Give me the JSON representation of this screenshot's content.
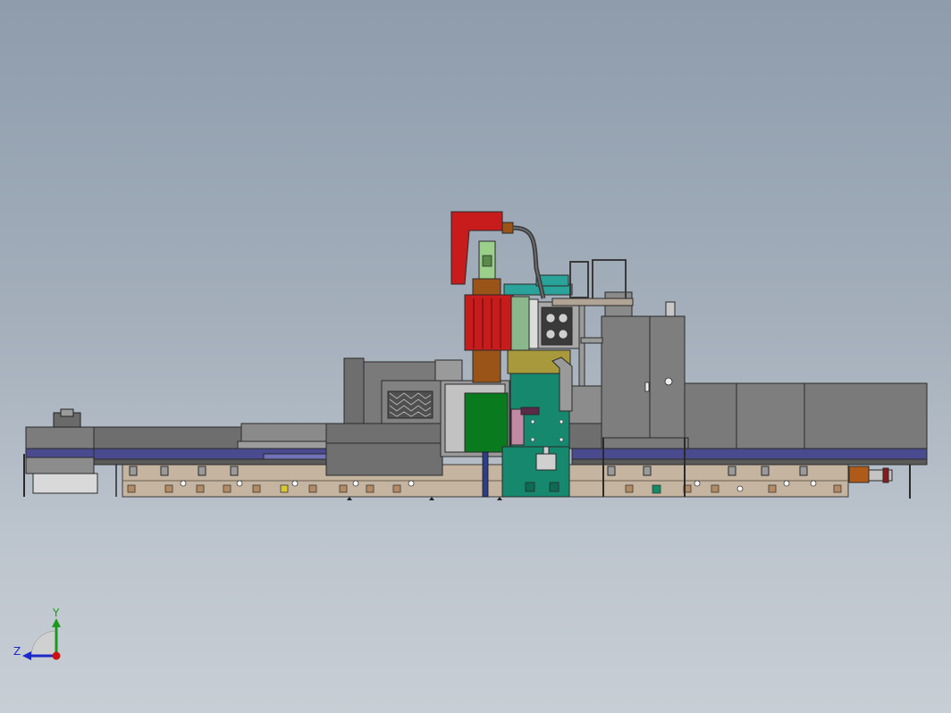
{
  "triad": {
    "y_label": "Y",
    "z_label": "Z",
    "y_color": "#1a9a1a",
    "z_color": "#1c28c8",
    "x_color": "#d01010"
  },
  "colors": {
    "background_top": "#8e9cac",
    "background_bottom": "#c8ced5",
    "machine_gray": "#7a7a7a",
    "base_tan": "#c4b4a0",
    "rail_blue": "#4a4a8e",
    "head_red": "#c81c1c",
    "column_teal": "#16886e",
    "panel_green": "#0a7a1e",
    "motor_brown": "#9a5418",
    "spindle_olive": "#a89a3c"
  }
}
